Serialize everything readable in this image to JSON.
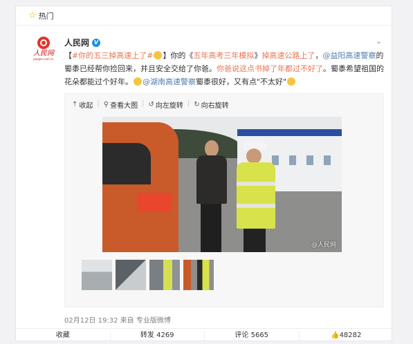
{
  "hot_bar": {
    "label": "热门"
  },
  "post": {
    "user": {
      "name": "人民网",
      "verified_mark": "V",
      "logo_script": "人民网",
      "logo_url": "people.com.cn"
    },
    "text": {
      "p1": "【",
      "topic": "#你的五三掉高速上了#",
      "p2": "】你的《",
      "book": "五年高考三年模拟",
      "p3": "》",
      "fell": "掉高速公路上了",
      "p4": "，",
      "mention1": "@益阳高速警察",
      "p5": "的蜀黍已经帮你捡回来，并且安全交给了你爸。",
      "quote": "你爸说这点书掉了年都过不好了",
      "p6": "。蜀黍希望祖国的花朵都能过个好年。",
      "mention2": "@湖南高速警察",
      "p7": "蜀黍很好，又有点\"不太好\""
    },
    "media_toolbar": {
      "collapse": "收起",
      "view_large": "查看大图",
      "rotate_left": "向左旋转",
      "rotate_right": "向右旋转"
    },
    "photo_watermark": "@人民网",
    "meta": {
      "date": "02月12日 19:32",
      "source": "来自 专业版微博"
    },
    "actions": {
      "favorite": "收藏",
      "repost": "转发 4269",
      "comment": "评论 5665",
      "like": "48282"
    }
  },
  "colors": {
    "link": "#eb7350",
    "mention": "#507daf",
    "accent": "#f7a600"
  }
}
